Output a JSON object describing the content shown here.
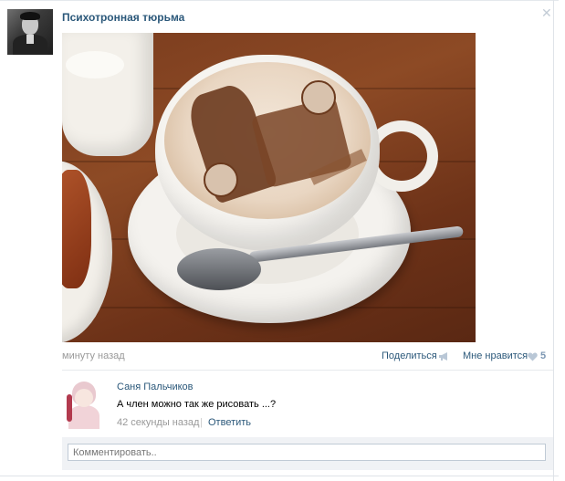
{
  "post": {
    "group_name": "Психотронная тюрьма",
    "time": "минуту назад",
    "share_label": "Поделиться",
    "like_label": "Мне нравится",
    "like_count": "5"
  },
  "comment": {
    "author": "Саня Пальчиков",
    "text": "А член можно так же рисовать ...?",
    "time": "42 секунды назад",
    "separator": "|",
    "reply_label": "Ответить"
  },
  "comment_box": {
    "placeholder": "Комментировать.."
  },
  "colors": {
    "link": "#2b587a",
    "muted": "#999999",
    "like_count": "#7d97b3",
    "close_icon": "#c3ccd6"
  },
  "icons": {
    "close": "close-icon",
    "share": "megaphone-icon",
    "like": "heart-icon"
  }
}
